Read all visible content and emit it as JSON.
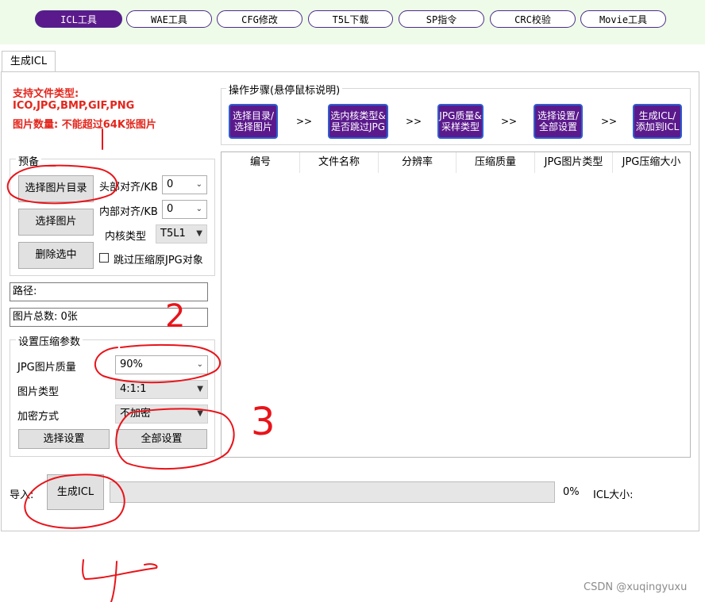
{
  "top_nav": [
    {
      "label": "ICL工具",
      "active": true
    },
    {
      "label": "WAE工具",
      "active": false
    },
    {
      "label": "CFG修改",
      "active": false
    },
    {
      "label": "T5L下载",
      "active": false
    },
    {
      "label": "SP指令",
      "active": false
    },
    {
      "label": "CRC校验",
      "active": false
    },
    {
      "label": "Movie工具",
      "active": false
    }
  ],
  "tab_label": "生成ICL",
  "info": {
    "line1": "支持文件类型:",
    "line2": "ICO,JPG,BMP,GIF,PNG",
    "line3": "图片数量: 不能超过64K张图片"
  },
  "prep": {
    "title": "预备",
    "btn_select_dir": "选择图片目录",
    "btn_select_img": "选择图片",
    "btn_delete": "删除选中",
    "header_align_label": "头部对齐/KB",
    "header_align_value": "0",
    "inner_align_label": "内部对齐/KB",
    "inner_align_value": "0",
    "core_type_label": "内核类型",
    "core_type_value": "T5L1",
    "skip_jpg_label": "跳过压缩原JPG对象"
  },
  "path_label": "路径:",
  "total_label": "图片总数: 0张",
  "compress": {
    "title": "设置压缩参数",
    "jpg_quality_label": "JPG图片质量",
    "jpg_quality_value": "90%",
    "img_type_label": "图片类型",
    "img_type_value": "4:1:1",
    "encrypt_label": "加密方式",
    "encrypt_value": "不加密",
    "btn_select_settings": "选择设置",
    "btn_all_settings": "全部设置"
  },
  "steps": {
    "title": "操作步骤(悬停鼠标说明)",
    "items": [
      {
        "line1": "选择目录/",
        "line2": "选择图片"
      },
      {
        "line1": "选内核类型&",
        "line2": "是否跳过JPG"
      },
      {
        "line1": "JPG质量&",
        "line2": "采样类型"
      },
      {
        "line1": "选择设置/",
        "line2": "全部设置"
      },
      {
        "line1": "生成ICL/",
        "line2": "添加到ICL"
      }
    ],
    "arrow": ">>"
  },
  "table": {
    "columns": [
      "编号",
      "文件名称",
      "分辨率",
      "压缩质量",
      "JPG图片类型",
      "JPG压缩大小"
    ]
  },
  "bottom": {
    "import_label": "导入:",
    "generate_button": "生成ICL",
    "progress_percent": 0,
    "progress_text": "0%",
    "icl_size_label": "ICL大小:"
  },
  "annotations": [
    "2",
    "3",
    "4"
  ],
  "watermark": "CSDN @xuqingyuxu",
  "colors": {
    "accent": "#5b1a8c",
    "step_border": "#2f5fd0",
    "info_red": "#e3261c",
    "annotation_red": "#e8141a",
    "topbar_bg": "#eefbe8"
  }
}
